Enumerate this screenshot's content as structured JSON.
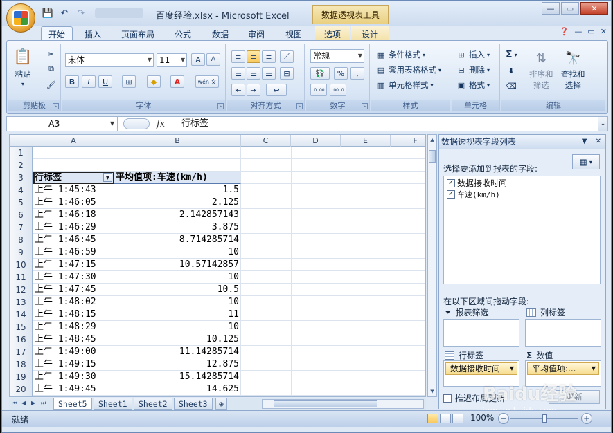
{
  "window": {
    "title": "百度经验.xlsx - Microsoft Excel",
    "context_title": "数据透视表工具"
  },
  "tabs": [
    "开始",
    "插入",
    "页面布局",
    "公式",
    "数据",
    "审阅",
    "视图",
    "选项",
    "设计"
  ],
  "ribbon": {
    "clipboard": {
      "label": "剪贴板",
      "paste": "粘贴"
    },
    "font": {
      "label": "字体",
      "name": "宋体",
      "size": "11",
      "bold": "B",
      "italic": "I",
      "underline": "U",
      "grow": "A",
      "shrink": "A",
      "font_color": "A",
      "wen": "wén 文"
    },
    "alignment": {
      "label": "对齐方式"
    },
    "number": {
      "label": "数字",
      "format": "常规",
      "percent": "%",
      "comma": ",",
      "inc": ".0 .00",
      "dec": ".00 .0"
    },
    "styles": {
      "label": "样式",
      "conditional": "条件格式",
      "table": "套用表格格式",
      "cell": "单元格样式"
    },
    "cells": {
      "label": "单元格",
      "insert": "插入",
      "delete": "删除",
      "format": "格式"
    },
    "editing": {
      "label": "编辑",
      "sigma": "Σ",
      "sort": "排序和",
      "sort2": "筛选",
      "find": "查找和",
      "find2": "选择"
    }
  },
  "formula_bar": {
    "name_box": "A3",
    "fx": "fx",
    "content": "行标签"
  },
  "columns": [
    "A",
    "B",
    "C",
    "D",
    "E",
    "F"
  ],
  "grid": {
    "header": {
      "row": "3",
      "a": "行标签",
      "b": "平均值项:车速(km/h)"
    },
    "rows": [
      {
        "row": "1",
        "a": "",
        "b": ""
      },
      {
        "row": "2",
        "a": "",
        "b": ""
      },
      {
        "row": "4",
        "a": "上午 1:45:43",
        "b": "1.5"
      },
      {
        "row": "5",
        "a": "上午 1:46:05",
        "b": "2.125"
      },
      {
        "row": "6",
        "a": "上午 1:46:18",
        "b": "2.142857143"
      },
      {
        "row": "7",
        "a": "上午 1:46:29",
        "b": "3.875"
      },
      {
        "row": "8",
        "a": "上午 1:46:45",
        "b": "8.714285714"
      },
      {
        "row": "9",
        "a": "上午 1:46:59",
        "b": "10"
      },
      {
        "row": "10",
        "a": "上午 1:47:15",
        "b": "10.57142857"
      },
      {
        "row": "11",
        "a": "上午 1:47:30",
        "b": "10"
      },
      {
        "row": "12",
        "a": "上午 1:47:45",
        "b": "10.5"
      },
      {
        "row": "13",
        "a": "上午 1:48:02",
        "b": "10"
      },
      {
        "row": "14",
        "a": "上午 1:48:15",
        "b": "11"
      },
      {
        "row": "15",
        "a": "上午 1:48:29",
        "b": "10"
      },
      {
        "row": "16",
        "a": "上午 1:48:45",
        "b": "10.125"
      },
      {
        "row": "17",
        "a": "上午 1:49:00",
        "b": "11.14285714"
      },
      {
        "row": "18",
        "a": "上午 1:49:15",
        "b": "12.875"
      },
      {
        "row": "19",
        "a": "上午 1:49:30",
        "b": "15.14285714"
      },
      {
        "row": "20",
        "a": "上午 1:49:45",
        "b": "14.625"
      }
    ]
  },
  "sheet_tabs": [
    "Sheet5",
    "Sheet1",
    "Sheet2",
    "Sheet3"
  ],
  "pivot_pane": {
    "title": "数据透视表字段列表",
    "choose_label": "选择要添加到报表的字段:",
    "fields": [
      {
        "name": "数据接收时间",
        "checked": true
      },
      {
        "name": "车速(km/h)",
        "checked": true
      }
    ],
    "drag_label": "在以下区域间拖动字段:",
    "report_filter": "报表筛选",
    "column_labels": "列标签",
    "row_labels": "行标签",
    "values": "数值",
    "row_chip": "数据接收时间",
    "values_chip": "平均值项:...",
    "defer_update": "推迟布局更新",
    "update_button": "更新"
  },
  "status": {
    "ready": "就绪",
    "zoom": "100%"
  },
  "watermark": {
    "brand": "Baidu经验",
    "url": "jingyan.baidu.com"
  }
}
